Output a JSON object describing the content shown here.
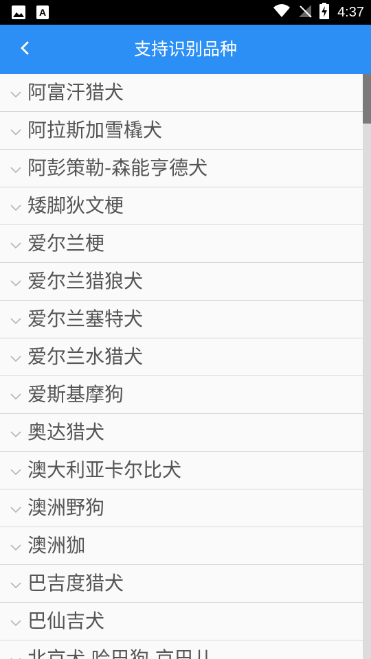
{
  "status_bar": {
    "time": "4:37",
    "left_icons": [
      "image-icon",
      "text-a-icon"
    ],
    "right_icons": [
      "wifi-icon",
      "no-signal-icon",
      "battery-charging-icon"
    ]
  },
  "header": {
    "title": "支持识别品种",
    "back_icon": "chevron-left-icon",
    "background": "#2b8ff5"
  },
  "breeds": [
    "阿富汗猎犬",
    "阿拉斯加雪橇犬",
    "阿彭策勒-森能亨德犬",
    "矮脚狄文梗",
    "爱尔兰梗",
    "爱尔兰猎狼犬",
    "爱尔兰塞特犬",
    "爱尔兰水猎犬",
    "爱斯基摩狗",
    "奥达猎犬",
    "澳大利亚卡尔比犬",
    "澳洲野狗",
    "澳洲㹢",
    "巴吉度猎犬",
    "巴仙吉犬",
    "北京犬 哈巴狗 京巴儿"
  ],
  "list_scroll_fraction": 0.0
}
